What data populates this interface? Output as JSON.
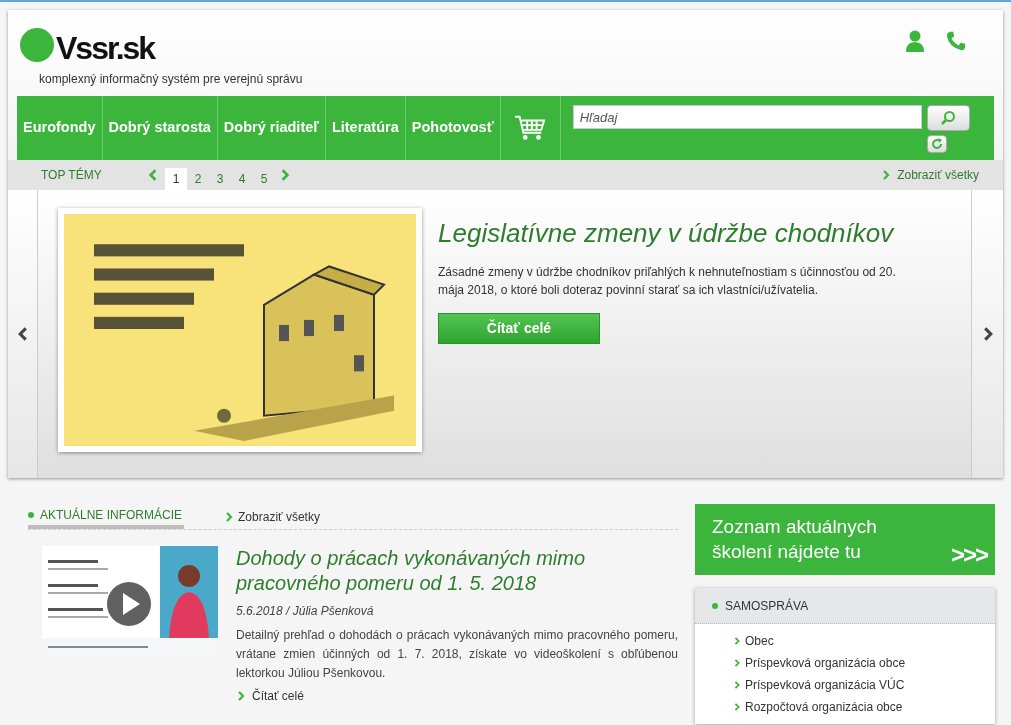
{
  "logo": {
    "text": "Vssr.sk",
    "tagline": "komplexný informačný systém pre verejnú správu"
  },
  "nav": {
    "items": [
      "Eurofondy",
      "Dobrý starosta",
      "Dobrý riaditeľ",
      "Literatúra",
      "Pohotovosť"
    ],
    "search": {
      "placeholder": "Hľadaj"
    }
  },
  "top_topics": {
    "title": "TOP TÉMY",
    "pages": [
      {
        "label": "1",
        "selected": true
      },
      {
        "label": "2",
        "selected": false
      },
      {
        "label": "3",
        "selected": false
      },
      {
        "label": "4",
        "selected": false
      },
      {
        "label": "5",
        "selected": false
      }
    ],
    "show_all": "Zobraziť všetky"
  },
  "slide": {
    "title": "Legislatívne zmeny v údržbe chodníkov",
    "text": "Zásadné zmeny v údržbe chodníkov priľahlých k nehnuteľnostiam s účinnosťou od 20. mája 2018, o ktoré boli doteraz povinní starať sa ich vlastníci/užívatelia.",
    "button": "Čítať celé"
  },
  "news": {
    "title": "AKTUÁLNE INFORMÁCIE",
    "show_all": "Zobraziť všetky",
    "article": {
      "title": "Dohody o prácach vykonávaných mimo pracovného pomeru od 1. 5. 2018",
      "date": "5.6.2018",
      "separator": "/",
      "author": "Júlia Pšenková",
      "text": "Detailný prehľad o dohodách o prácach vykonávaných mimo pracovného pomeru, vrátane zmien účinných od 1. 7. 2018, získate vo videoškolení s obľúbenou lektorkou Júliou Pšenkovou.",
      "read_more": "Čítať celé"
    }
  },
  "training_banner": {
    "text": "Zoznam aktuálnych školení nájdete tu",
    "arrows": ">>>"
  },
  "samosprava": {
    "title": "SAMOSPRÁVA",
    "items": [
      "Obec",
      "Príspevková organizácia obce",
      "Príspevková organizácia VÚC",
      "Rozpočtová organizácia obce"
    ]
  }
}
